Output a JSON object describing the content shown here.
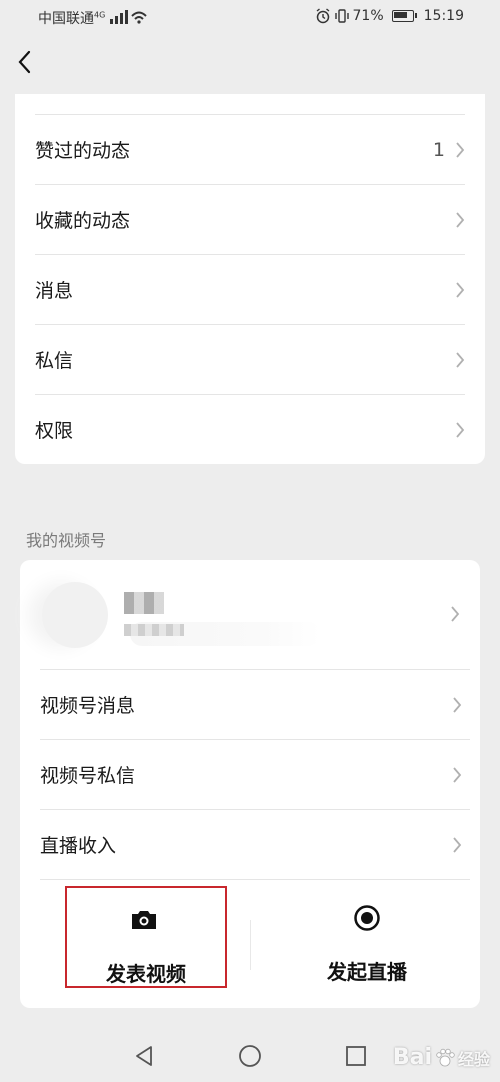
{
  "status": {
    "carrier": "中国联通",
    "network": "4G",
    "battery": "71%",
    "time": "15:19"
  },
  "menu1": [
    {
      "label": "赞过的动态",
      "count": "1"
    },
    {
      "label": "收藏的动态"
    },
    {
      "label": "消息"
    },
    {
      "label": "私信"
    },
    {
      "label": "权限"
    }
  ],
  "channels": {
    "section_title": "我的视频号",
    "items": [
      {
        "label": "视频号消息"
      },
      {
        "label": "视频号私信"
      },
      {
        "label": "直播收入"
      }
    ],
    "actions": {
      "post_video": "发表视频",
      "start_live": "发起直播"
    }
  },
  "watermark": {
    "brand": "Bai",
    "suffix": "经验"
  },
  "colors": {
    "highlight": "#c8272d",
    "background": "#ededed"
  }
}
